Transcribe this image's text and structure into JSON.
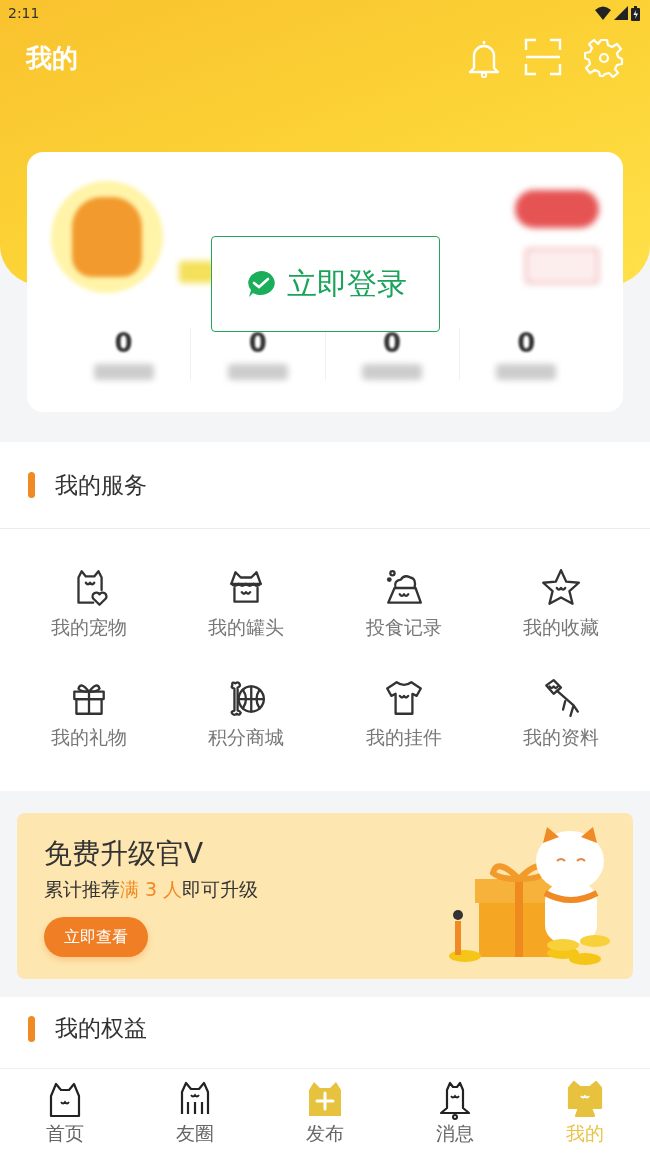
{
  "status_bar": {
    "time": "2:11"
  },
  "header": {
    "title": "我的"
  },
  "profile": {
    "login_button": "立即登录",
    "stats": [
      {
        "value": "0"
      },
      {
        "value": "0"
      },
      {
        "value": "0"
      },
      {
        "value": "0"
      }
    ]
  },
  "services": {
    "title": "我的服务",
    "items": [
      {
        "label": "我的宠物",
        "kind": "pet"
      },
      {
        "label": "我的罐头",
        "kind": "can"
      },
      {
        "label": "投食记录",
        "kind": "feed"
      },
      {
        "label": "我的收藏",
        "kind": "star"
      },
      {
        "label": "我的礼物",
        "kind": "gift"
      },
      {
        "label": "积分商城",
        "kind": "shop"
      },
      {
        "label": "我的挂件",
        "kind": "shirt"
      },
      {
        "label": "我的资料",
        "kind": "profile"
      }
    ]
  },
  "promo": {
    "title": "免费升级官V",
    "subtitle": [
      {
        "text": "累计推荐",
        "highlight": false
      },
      {
        "text": "满 3 人",
        "highlight": true
      },
      {
        "text": "即可升级",
        "highlight": false
      }
    ],
    "button": "立即查看"
  },
  "benefits": {
    "title": "我的权益"
  },
  "tab_bar": [
    {
      "label": "首页",
      "kind": "home",
      "selected": false
    },
    {
      "label": "友圈",
      "kind": "friends",
      "selected": false
    },
    {
      "label": "发布",
      "kind": "publish",
      "selected": false
    },
    {
      "label": "消息",
      "kind": "message",
      "selected": false
    },
    {
      "label": "我的",
      "kind": "mine",
      "selected": true
    }
  ]
}
